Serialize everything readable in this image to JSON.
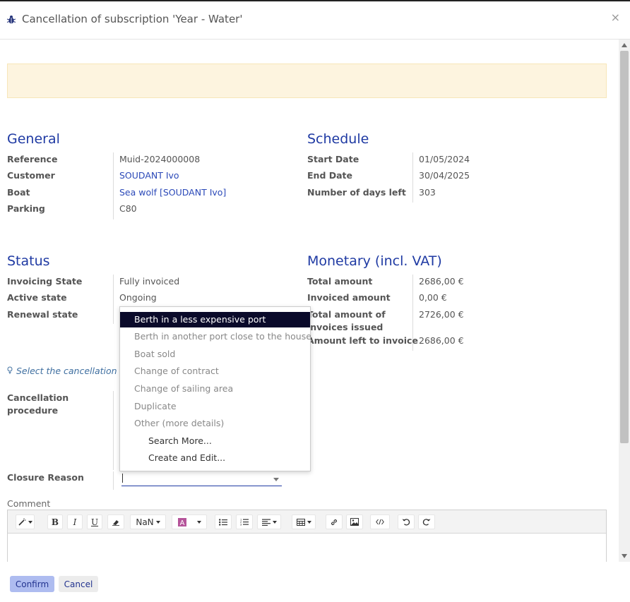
{
  "dialog": {
    "title": "Cancellation of subscription 'Year - Water'",
    "close": "×"
  },
  "general": {
    "title": "General",
    "rows": [
      {
        "label": "Reference",
        "value": "Muid-2024000008"
      },
      {
        "label": "Customer",
        "value": "SOUDANT Ivo"
      },
      {
        "label": "Boat",
        "value": "Sea wolf [SOUDANT Ivo]"
      },
      {
        "label": "Parking",
        "value": "C80"
      }
    ]
  },
  "schedule": {
    "title": "Schedule",
    "rows": [
      {
        "label": "Start Date",
        "value": "01/05/2024"
      },
      {
        "label": "End Date",
        "value": "30/04/2025"
      },
      {
        "label": "Number of days left",
        "value": "303"
      }
    ]
  },
  "status": {
    "title": "Status",
    "rows": [
      {
        "label": "Invoicing State",
        "value": "Fully invoiced"
      },
      {
        "label": "Active state",
        "value": "Ongoing"
      },
      {
        "label": "Renewal state",
        "value": ""
      }
    ]
  },
  "monetary": {
    "title": "Monetary (incl. VAT)",
    "rows": [
      {
        "label": "Total amount",
        "value": "2686,00 €"
      },
      {
        "label": "Invoiced amount",
        "value": "0,00 €"
      },
      {
        "label_line1": "Total amount of",
        "label_line2": "invoices issued",
        "value": "2726,00 €"
      },
      {
        "label": "Amount left to invoice",
        "value": "2686,00 €"
      }
    ]
  },
  "hint": "Select the cancellation pro",
  "cancellation": {
    "label_line1": "Cancellation",
    "label_line2": "procedure"
  },
  "closure": {
    "label": "Closure Reason",
    "value": ""
  },
  "dropdown": {
    "options": [
      "Berth in a less expensive port",
      "Berth in another port close to the house",
      "Boat sold",
      "Change of contract",
      "Change of sailing area",
      "Duplicate",
      "Other (more details)"
    ],
    "search_more": "Search More...",
    "create_edit": "Create and Edit..."
  },
  "comment": {
    "label": "Comment",
    "toolbar": {
      "bold": "B",
      "italic": "I",
      "underline": "U",
      "font_size": "NaN"
    }
  },
  "footer": {
    "confirm": "Confirm",
    "cancel": "Cancel"
  },
  "colors": {
    "section_title": "#1f3aa3",
    "link": "#2b49b8",
    "alert_bg": "#fdf4df",
    "dropdown_active": "#0a0a2a",
    "confirm_bg": "#aebcf0"
  }
}
